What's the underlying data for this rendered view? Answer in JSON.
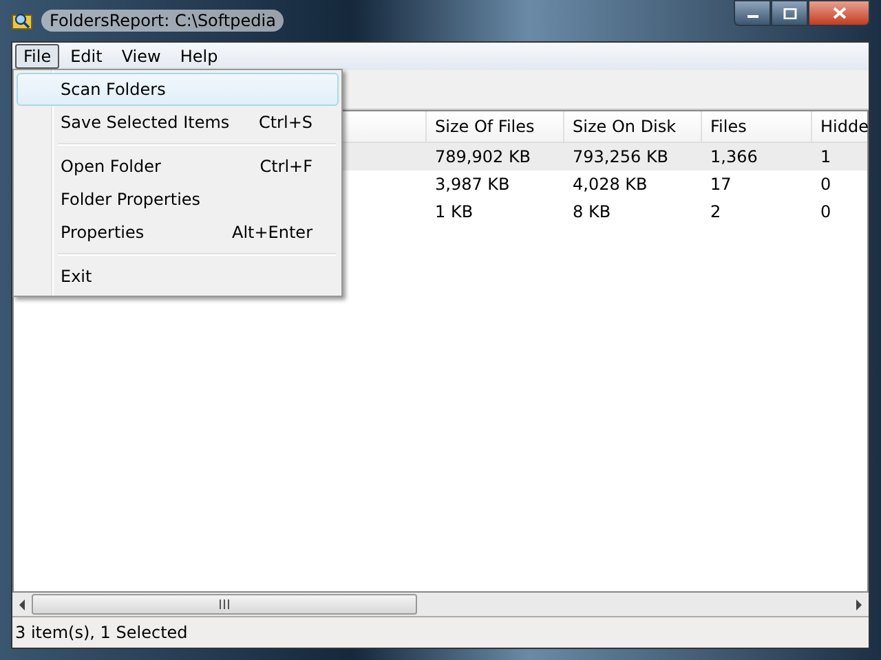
{
  "window": {
    "title": "FoldersReport: C:\\Softpedia"
  },
  "menu_bar": [
    {
      "label": "File",
      "selected": true
    },
    {
      "label": "Edit",
      "selected": false
    },
    {
      "label": "View",
      "selected": false
    },
    {
      "label": "Help",
      "selected": false
    }
  ],
  "file_menu": [
    {
      "kind": "item",
      "label": "Scan Folders",
      "selected": true
    },
    {
      "kind": "item",
      "label": "Save Selected Items",
      "shortcut": "Ctrl+S",
      "selected": false
    },
    {
      "kind": "separator"
    },
    {
      "kind": "item",
      "label": "Open Folder",
      "shortcut": "Ctrl+F",
      "selected": false
    },
    {
      "kind": "item",
      "label": "Folder Properties",
      "selected": false
    },
    {
      "kind": "item",
      "label": "Properties",
      "shortcut": "Alt+Enter",
      "selected": false
    },
    {
      "kind": "separator"
    },
    {
      "kind": "item",
      "label": "Exit",
      "selected": false
    }
  ],
  "table": {
    "columns": [
      "Size Of Files",
      "Size On Disk",
      "Files",
      "Hidde"
    ],
    "rows": [
      {
        "cells": [
          "789,902 KB",
          "793,256 KB",
          "1,366",
          "1"
        ],
        "selected": true
      },
      {
        "cells": [
          "3,987 KB",
          "4,028 KB",
          "17",
          "0"
        ],
        "selected": false
      },
      {
        "cells": [
          "1 KB",
          "8 KB",
          "2",
          "0"
        ],
        "selected": false
      }
    ]
  },
  "status_bar": "3 item(s), 1 Selected"
}
